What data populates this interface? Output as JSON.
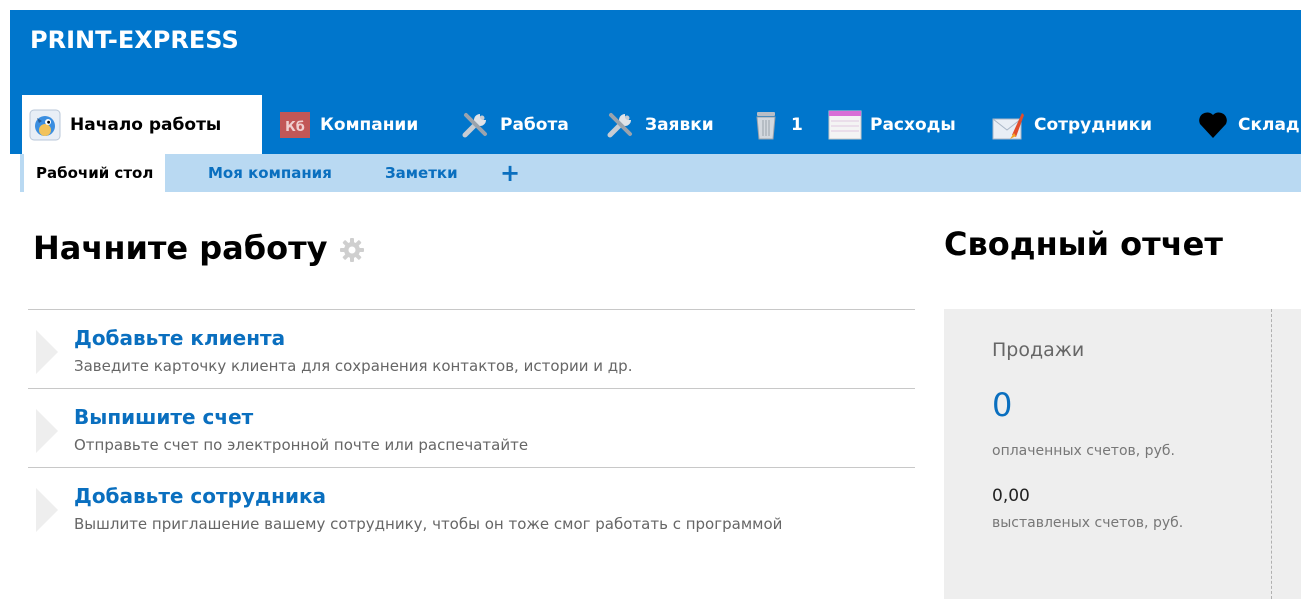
{
  "app": {
    "title": "PRINT-EXPRESS"
  },
  "tabs": [
    {
      "label": "Начало работы",
      "icon": "bird-icon",
      "active": true
    },
    {
      "label": "Компании",
      "icon": "contacts-book-icon",
      "badge_text": "Кб"
    },
    {
      "label": "Работа",
      "icon": "tools-icon"
    },
    {
      "label": "Заявки",
      "icon": "tools-icon"
    },
    {
      "label": "1",
      "icon": "trash-icon"
    },
    {
      "label": "Расходы",
      "icon": "ledger-icon"
    },
    {
      "label": "Сотрудники",
      "icon": "rocket-mail-icon"
    },
    {
      "label": "Склад",
      "icon": "heart-icon"
    }
  ],
  "subnav": {
    "items": [
      {
        "label": "Рабочий стол",
        "active": true
      },
      {
        "label": "Моя компания"
      },
      {
        "label": "Заметки"
      }
    ],
    "add_label": "+"
  },
  "getting_started": {
    "title": "Начните работу",
    "steps": [
      {
        "title": "Добавьте клиента",
        "description": "Заведите карточку клиента для сохранения контактов, истории и др."
      },
      {
        "title": "Выпишите счет",
        "description": "Отправьте счет по электронной почте или распечатайте"
      },
      {
        "title": "Добавьте сотрудника",
        "description": "Вышлите приглашение вашему сотруднику, чтобы он тоже смог работать с программой"
      }
    ]
  },
  "summary": {
    "title": "Сводный отчет",
    "sales_label": "Продажи",
    "paid_value": "0",
    "paid_caption": "оплаченных счетов, руб.",
    "issued_value": "0,00",
    "issued_caption": "выставленых счетов, руб."
  },
  "colors": {
    "header_blue": "#0076cc",
    "subnav_bg": "#b9d9f2",
    "link_blue": "#0a6fbf",
    "summary_bg": "#eeeeee"
  }
}
